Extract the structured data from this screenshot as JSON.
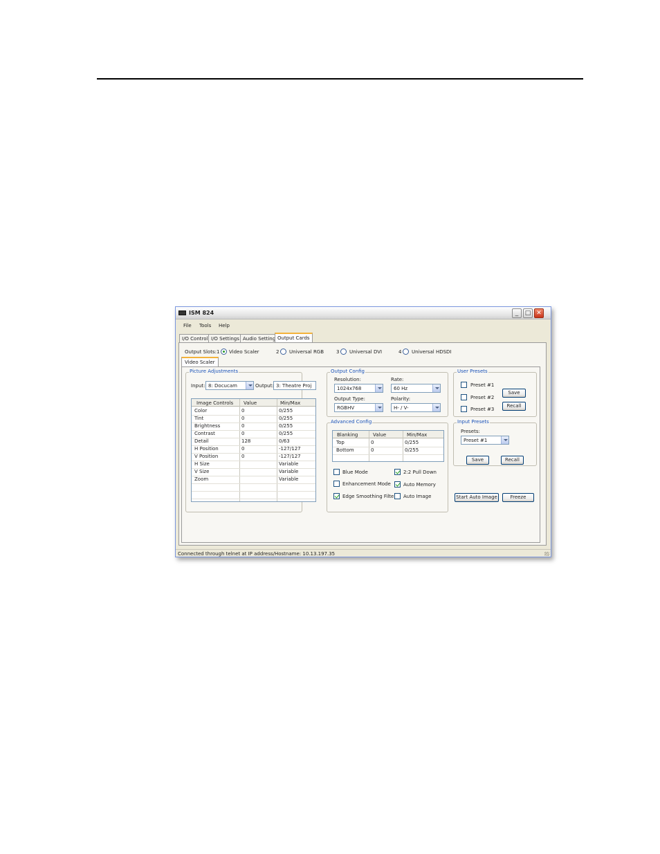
{
  "window": {
    "title": "ISM 824",
    "menu": [
      "File",
      "Tools",
      "Help"
    ],
    "tabs": [
      "I/O Control",
      "I/O Settings",
      "Audio Settings",
      "Output Cards"
    ],
    "active_tab": "Output Cards"
  },
  "output_slots": {
    "label": "Output Slots:",
    "slots": [
      {
        "num": "1",
        "name": "Video Scaler",
        "selected": true
      },
      {
        "num": "2",
        "name": "Universal RGB",
        "selected": false
      },
      {
        "num": "3",
        "name": "Universal DVI",
        "selected": false
      },
      {
        "num": "4",
        "name": "Universal HDSDI",
        "selected": false
      }
    ]
  },
  "subtab": "Video Scaler",
  "picture_adjustments": {
    "title": "Picture Adjustments",
    "input_label": "Input:",
    "input_value": "8: Docucam",
    "output_label": "Output:",
    "output_value": "3: Theatre Proj",
    "columns": [
      "Image Controls",
      "Value",
      "Min/Max"
    ],
    "rows": [
      [
        "Color",
        "0",
        "0/255"
      ],
      [
        "Tint",
        "0",
        "0/255"
      ],
      [
        "Brightness",
        "0",
        "0/255"
      ],
      [
        "Contrast",
        "0",
        "0/255"
      ],
      [
        "Detail",
        "128",
        "0/63"
      ],
      [
        "H Position",
        "0",
        "-127/127"
      ],
      [
        "V Position",
        "0",
        "-127/127"
      ],
      [
        "H Size",
        "",
        "Variable"
      ],
      [
        "V Size",
        "",
        "Variable"
      ],
      [
        "Zoom",
        "",
        "Variable"
      ]
    ]
  },
  "output_config": {
    "title": "Output Config",
    "resolution_label": "Resolution:",
    "resolution_value": "1024x768",
    "rate_label": "Rate:",
    "rate_value": "60 Hz",
    "output_type_label": "Output Type:",
    "output_type_value": "RGBHV",
    "polarity_label": "Polarity:",
    "polarity_value": "H- / V-"
  },
  "advanced_config": {
    "title": "Advanced Config",
    "columns": [
      "Blanking",
      "Value",
      "Min/Max"
    ],
    "rows": [
      [
        "Top",
        "0",
        "0/255"
      ],
      [
        "Bottom",
        "0",
        "0/255"
      ]
    ],
    "checkboxes": [
      {
        "label": "Blue Mode",
        "checked": false
      },
      {
        "label": "2:2 Pull Down",
        "checked": true
      },
      {
        "label": "Enhancement Mode",
        "checked": false
      },
      {
        "label": "Auto Memory",
        "checked": true
      },
      {
        "label": "Edge Smoothing Filter",
        "checked": true
      },
      {
        "label": "Auto Image",
        "checked": false
      }
    ]
  },
  "user_presets": {
    "title": "User Presets",
    "presets": [
      "Preset #1",
      "Preset #2",
      "Preset #3"
    ],
    "save_label": "Save",
    "recall_label": "Recall"
  },
  "input_presets": {
    "title": "Input Presets",
    "presets_label": "Presets:",
    "preset_value": "Preset #1",
    "save_label": "Save",
    "recall_label": "Recall"
  },
  "actions": {
    "start_auto_image": "Start Auto Image",
    "freeze": "Freeze"
  },
  "status": "Connected through telnet at IP address/Hostname: 10.13.197.35"
}
